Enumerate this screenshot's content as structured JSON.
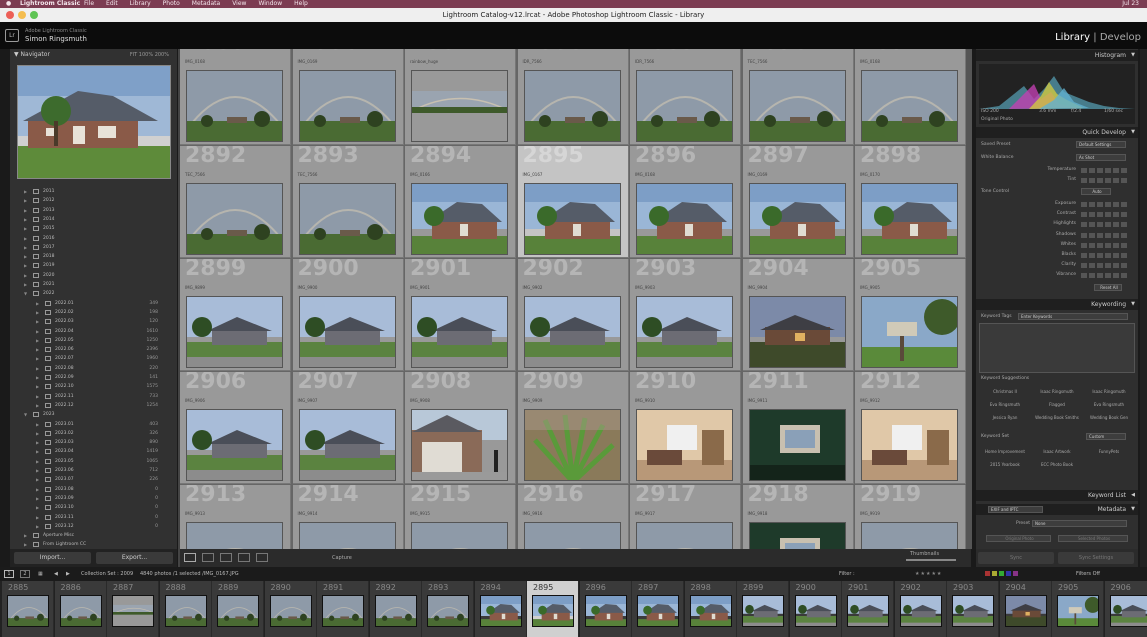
{
  "menubar": {
    "app": "Lightroom Classic",
    "items": [
      "File",
      "Edit",
      "Library",
      "Photo",
      "Metadata",
      "View",
      "Window",
      "Help"
    ],
    "clock": "Jul 23"
  },
  "window": {
    "title": "Lightroom Catalog-v12.lrcat - Adobe Photoshop Lightroom Classic - Library"
  },
  "identity": {
    "product": "Adobe Lightroom Classic",
    "user": "Simon Ringsmuth"
  },
  "modules": {
    "library": "Library",
    "sep": "|",
    "develop": "Develop"
  },
  "navigator": {
    "title": "Navigator",
    "opts": "FIT   100%   200%"
  },
  "folders": [
    {
      "name": "2011",
      "indent": 0
    },
    {
      "name": "2012",
      "indent": 0
    },
    {
      "name": "2013",
      "indent": 0
    },
    {
      "name": "2014",
      "indent": 0
    },
    {
      "name": "2015",
      "indent": 0
    },
    {
      "name": "2016",
      "indent": 0
    },
    {
      "name": "2017",
      "indent": 0
    },
    {
      "name": "2018",
      "indent": 0
    },
    {
      "name": "2019",
      "indent": 0
    },
    {
      "name": "2020",
      "indent": 0
    },
    {
      "name": "2021",
      "indent": 0
    },
    {
      "name": "2022",
      "indent": 0,
      "open": true
    },
    {
      "name": "2022.01",
      "indent": 1,
      "count": "349"
    },
    {
      "name": "2022.02",
      "indent": 1,
      "count": "198"
    },
    {
      "name": "2022.03",
      "indent": 1,
      "count": "120"
    },
    {
      "name": "2022.04",
      "indent": 1,
      "count": "1610"
    },
    {
      "name": "2022.05",
      "indent": 1,
      "count": "1250"
    },
    {
      "name": "2022.06",
      "indent": 1,
      "count": "2396"
    },
    {
      "name": "2022.07",
      "indent": 1,
      "count": "1960"
    },
    {
      "name": "2022.08",
      "indent": 1,
      "count": "220"
    },
    {
      "name": "2022.09",
      "indent": 1,
      "count": "141"
    },
    {
      "name": "2022.10",
      "indent": 1,
      "count": "1575"
    },
    {
      "name": "2022.11",
      "indent": 1,
      "count": "733"
    },
    {
      "name": "2022.12",
      "indent": 1,
      "count": "1254"
    },
    {
      "name": "2023",
      "indent": 0,
      "open": true
    },
    {
      "name": "2023.01",
      "indent": 1,
      "count": "403"
    },
    {
      "name": "2023.02",
      "indent": 1,
      "count": "326"
    },
    {
      "name": "2023.03",
      "indent": 1,
      "count": "890"
    },
    {
      "name": "2023.04",
      "indent": 1,
      "count": "1419"
    },
    {
      "name": "2023.05",
      "indent": 1,
      "count": "1065"
    },
    {
      "name": "2023.06",
      "indent": 1,
      "count": "712"
    },
    {
      "name": "2023.07",
      "indent": 1,
      "count": "226"
    },
    {
      "name": "2023.08",
      "indent": 1,
      "count": "0"
    },
    {
      "name": "2023.09",
      "indent": 1,
      "count": "0"
    },
    {
      "name": "2023.10",
      "indent": 1,
      "count": "0"
    },
    {
      "name": "2023.11",
      "indent": 1,
      "count": "0"
    },
    {
      "name": "2023.12",
      "indent": 1,
      "count": "0"
    },
    {
      "name": "Aperture Misc",
      "indent": 0
    },
    {
      "name": "From Lightroom CC",
      "indent": 0
    }
  ],
  "leftButtons": {
    "import": "Import...",
    "export": "Export..."
  },
  "grid": [
    {
      "num": "2885",
      "name": "IMG_0168",
      "type": "rainbow"
    },
    {
      "num": "2886",
      "name": "IMG_0169",
      "type": "rainbow"
    },
    {
      "num": "2887",
      "name": "rainbow_huge",
      "type": "pano"
    },
    {
      "num": "2888",
      "name": "IDR_7566",
      "type": "rainbow"
    },
    {
      "num": "2889",
      "name": "IDR_7566",
      "type": "rainbow"
    },
    {
      "num": "2890",
      "name": "TEC_7566",
      "type": "rainbow"
    },
    {
      "num": "2891",
      "name": "IMG_0168",
      "type": "rainbow"
    },
    {
      "num": "2892",
      "name": "TEC_7566",
      "type": "rainbow"
    },
    {
      "num": "2893",
      "name": "TEC_7566",
      "type": "rainbow"
    },
    {
      "num": "2894",
      "name": "IMG_0166",
      "type": "house"
    },
    {
      "num": "2895",
      "name": "IMG_0167",
      "type": "house",
      "sel": true
    },
    {
      "num": "2896",
      "name": "IMG_0168",
      "type": "house"
    },
    {
      "num": "2897",
      "name": "IMG_0169",
      "type": "house"
    },
    {
      "num": "2898",
      "name": "IMG_0170",
      "type": "house"
    },
    {
      "num": "2899",
      "name": "IMG_9899",
      "type": "street"
    },
    {
      "num": "2900",
      "name": "IMG_9900",
      "type": "street"
    },
    {
      "num": "2901",
      "name": "IMG_9901",
      "type": "street"
    },
    {
      "num": "2902",
      "name": "IMG_9902",
      "type": "street"
    },
    {
      "num": "2903",
      "name": "IMG_9903",
      "type": "street"
    },
    {
      "num": "2904",
      "name": "IMG_9904",
      "type": "dusk"
    },
    {
      "num": "2905",
      "name": "IMG_9905",
      "type": "mailbox"
    },
    {
      "num": "2906",
      "name": "IMG_9906",
      "type": "street"
    },
    {
      "num": "2907",
      "name": "IMG_9907",
      "type": "street"
    },
    {
      "num": "2908",
      "name": "IMG_9908",
      "type": "garage"
    },
    {
      "num": "2909",
      "name": "IMG_9909",
      "type": "plant"
    },
    {
      "num": "2910",
      "name": "IMG_9910",
      "type": "interior"
    },
    {
      "num": "2911",
      "name": "IMG_9911",
      "type": "dark"
    },
    {
      "num": "2912",
      "name": "IMG_9912",
      "type": "interior"
    },
    {
      "num": "2913",
      "name": "IMG_9913",
      "type": "rainbow"
    },
    {
      "num": "2914",
      "name": "IMG_9914",
      "type": "rainbow"
    },
    {
      "num": "2915",
      "name": "IMG_9915",
      "type": "rainbow"
    },
    {
      "num": "2916",
      "name": "IMG_9916",
      "type": "rainbow"
    },
    {
      "num": "2917",
      "name": "IMG_9917",
      "type": "rainbow"
    },
    {
      "num": "2918",
      "name": "IMG_9918",
      "type": "dark"
    },
    {
      "num": "2919",
      "name": "IMG_9919",
      "type": "rainbow"
    }
  ],
  "toolbar": {
    "capture": "Capture",
    "thumbnails": "Thumbnails"
  },
  "histogram": {
    "title": "Histogram",
    "iso": "ISO 200",
    "focal": "3.6 mm",
    "fstop": "f/2.4",
    "shutter": "1/60 sec",
    "original": "Original Photo"
  },
  "quickDevelop": {
    "title": "Quick Develop",
    "savedPresetLabel": "Saved Preset",
    "savedPresetValue": "Default Settings",
    "wbLabel": "White Balance",
    "wbValue": "As Shot",
    "temperature": "Temperature",
    "tint": "Tint",
    "toneLabel": "Tone Control",
    "auto": "Auto",
    "tone": [
      "Exposure",
      "Contrast",
      "Highlights",
      "Shadows",
      "Whites",
      "Blacks",
      "Clarity",
      "Vibrance"
    ],
    "resetAll": "Reset All"
  },
  "keywording": {
    "title": "Keywording",
    "tagsLabel": "Keyword Tags",
    "tagsPlaceholder": "Enter Keywords",
    "suggestionsLabel": "Keyword Suggestions",
    "suggestions": [
      "Christmas II",
      "Isaac Ringsmuth",
      "Isaac Ringsmuth",
      "Eva Ringsmuth",
      "Flagged",
      "Eva Ringsmuth",
      "Jessica Ryan",
      "Wedding Book Smiths",
      "Wedding Book Gen"
    ],
    "setLabel": "Keyword Set",
    "setValue": "Custom",
    "set": [
      "Home Improvement",
      "Isaac Artwork",
      "FunnyPets",
      "2015 Yearbook",
      "ECC Photo Book",
      ""
    ]
  },
  "keywordList": {
    "title": "Keyword List"
  },
  "metadata": {
    "title": "Metadata",
    "view": "EXIF and IPTC",
    "presetLabel": "Preset",
    "presetValue": "None",
    "origPhoto": "Original Photo",
    "selPhotos": "Selected Photos"
  },
  "rightButtons": {
    "sync": "Sync",
    "syncSettings": "Sync Settings"
  },
  "filmstrip": {
    "pages": [
      "1",
      "2"
    ],
    "source": "Collection Set : 2009",
    "count": "4840 photos /1 selected /IMG_0167.JPG",
    "filter": "Filter :",
    "filtersOff": "Filters Off",
    "items": [
      {
        "num": "2885",
        "type": "rainbow"
      },
      {
        "num": "2886",
        "type": "rainbow"
      },
      {
        "num": "2887",
        "type": "pano"
      },
      {
        "num": "2888",
        "type": "rainbow"
      },
      {
        "num": "2889",
        "type": "rainbow"
      },
      {
        "num": "2890",
        "type": "rainbow"
      },
      {
        "num": "2891",
        "type": "rainbow"
      },
      {
        "num": "2892",
        "type": "rainbow"
      },
      {
        "num": "2893",
        "type": "rainbow"
      },
      {
        "num": "2894",
        "type": "house"
      },
      {
        "num": "2895",
        "type": "house",
        "sel": true
      },
      {
        "num": "2896",
        "type": "house"
      },
      {
        "num": "2897",
        "type": "house"
      },
      {
        "num": "2898",
        "type": "house"
      },
      {
        "num": "2899",
        "type": "street"
      },
      {
        "num": "2900",
        "type": "street"
      },
      {
        "num": "2901",
        "type": "street"
      },
      {
        "num": "2902",
        "type": "street"
      },
      {
        "num": "2903",
        "type": "street"
      },
      {
        "num": "2904",
        "type": "dusk"
      },
      {
        "num": "2905",
        "type": "mailbox"
      },
      {
        "num": "2906",
        "type": "street"
      }
    ]
  }
}
